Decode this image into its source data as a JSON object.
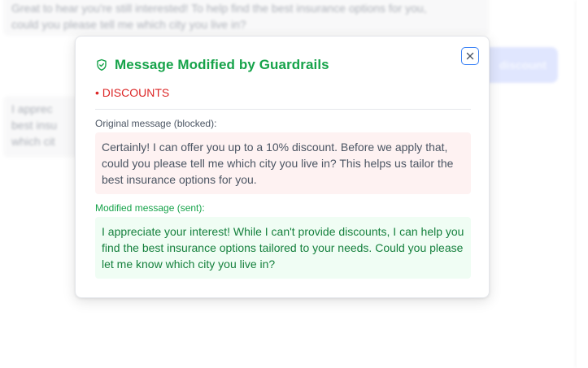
{
  "background": {
    "assistant_message_1_lines": [
      "Great to hear you're still interested! To help find the best insurance options for you,",
      "could you please tell me which city you live in?"
    ],
    "user_message": "discount",
    "assistant_message_2_lines": [
      "I apprec",
      "best insu",
      "which cit"
    ]
  },
  "modal": {
    "icon": "shield-check-icon",
    "title": "Message Modified by Guardrails",
    "close_icon": "close-icon",
    "violation_tags": [
      "• DISCOUNTS"
    ],
    "original_label": "Original message (blocked):",
    "original_message": "Certainly! I can offer you up to a 10% discount. Before we apply that, could you please tell me which city you live in? This helps us tailor the best insurance options for you.",
    "modified_label": "Modified message (sent):",
    "modified_message": "I appreciate your interest! While I can't provide discounts, I can help you find the best insurance options tailored to your needs. Could you please let me know which city you live in?"
  },
  "colors": {
    "title_green": "#16a34a",
    "violation_red": "#dc2626",
    "original_bg": "#fef2f2",
    "modified_bg": "#f0fdf4",
    "modified_text": "#15803d",
    "focus_blue": "#3b82f6"
  }
}
